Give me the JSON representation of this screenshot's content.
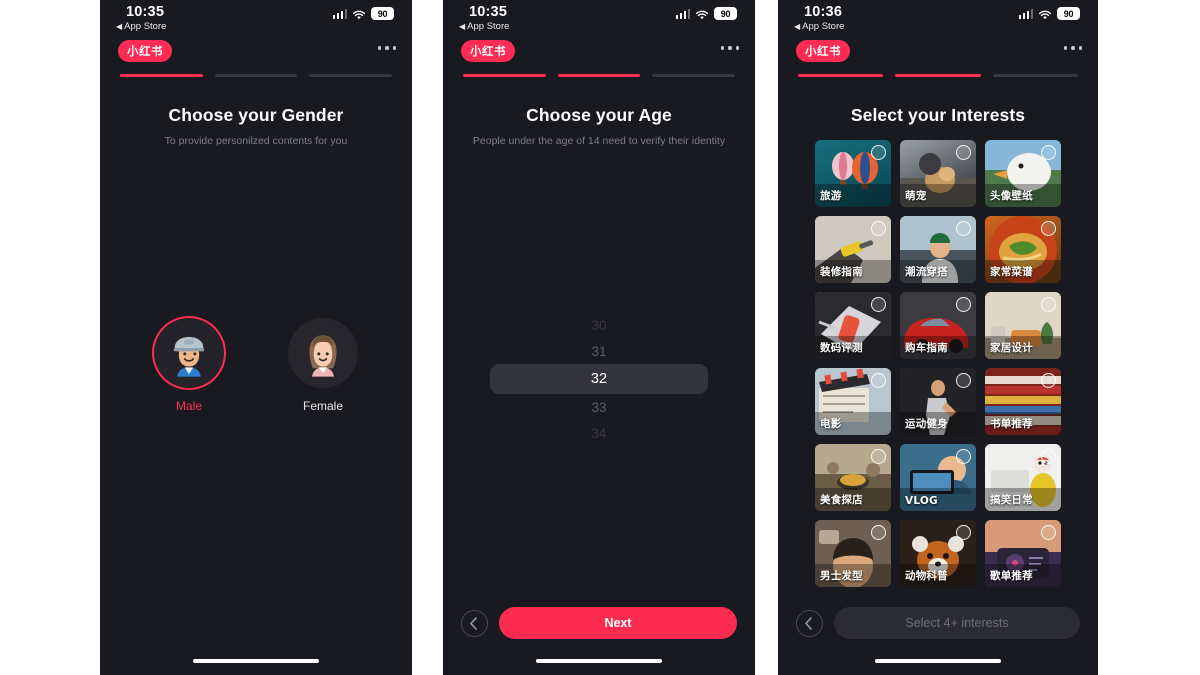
{
  "screens": [
    {
      "id": "gender",
      "status": {
        "time": "10:35",
        "back_app": "App Store",
        "battery": "90"
      },
      "header": {
        "logo": "小红书",
        "menu": "more-options"
      },
      "progress": {
        "total": 3,
        "active": 1
      },
      "title": "Choose your Gender",
      "subtitle": "To provide personilzed contents for you",
      "genders": [
        {
          "label": "Male",
          "selected": true
        },
        {
          "label": "Female",
          "selected": false
        }
      ]
    },
    {
      "id": "age",
      "status": {
        "time": "10:35",
        "back_app": "App Store",
        "battery": "90"
      },
      "header": {
        "logo": "小红书",
        "menu": "more-options"
      },
      "progress": {
        "total": 3,
        "active": 2
      },
      "title": "Choose your Age",
      "subtitle": "People under the age of 14 need to verify their identity",
      "age_picker": {
        "options": [
          "30",
          "31",
          "32",
          "33",
          "34"
        ],
        "selected": "32",
        "selected_index": 2
      },
      "bottom": {
        "back": "back-chevron",
        "cta_label": "Next",
        "cta_enabled": true
      }
    },
    {
      "id": "interests",
      "status": {
        "time": "10:36",
        "back_app": "App Store",
        "battery": "90"
      },
      "header": {
        "logo": "小红书",
        "menu": "more-options"
      },
      "progress": {
        "total": 3,
        "active": 2
      },
      "title": "Select your Interests",
      "bottom": {
        "back": "back-chevron",
        "cta_label": "Select 4+ interests",
        "cta_enabled": false
      },
      "interests": [
        {
          "label": "旅游",
          "img": "hot-air-balloons",
          "c1": "#17707e",
          "c2": "#0c4b58",
          "kind": "balloons"
        },
        {
          "label": "萌宠",
          "img": "man-with-dog",
          "c1": "#9aa0a6",
          "c2": "#3a3d42",
          "kind": "pets"
        },
        {
          "label": "头像壁纸",
          "img": "duck-closeup",
          "c1": "#8fb9d8",
          "c2": "#4a6b4e",
          "kind": "duck"
        },
        {
          "label": "装修指南",
          "img": "drill-wall",
          "c1": "#c9c3bb",
          "c2": "#6e6760",
          "kind": "drill"
        },
        {
          "label": "潮流穿搭",
          "img": "man-green-cap",
          "c1": "#b7c4cc",
          "c2": "#4e5a63",
          "kind": "fashion"
        },
        {
          "label": "家常菜谱",
          "img": "noodle-bowl",
          "c1": "#d4661f",
          "c2": "#6c3f14",
          "kind": "food"
        },
        {
          "label": "数码评测",
          "img": "phone-and-laptop",
          "c1": "#d8d8dc",
          "c2": "#2c2c31",
          "kind": "tech"
        },
        {
          "label": "购车指南",
          "img": "red-sports-car",
          "c1": "#c2282a",
          "c2": "#4b1718",
          "kind": "car"
        },
        {
          "label": "家居设计",
          "img": "living-room",
          "c1": "#d8cbb8",
          "c2": "#6d604f",
          "kind": "interior"
        },
        {
          "label": "电影",
          "img": "clapperboard",
          "c1": "#9db4c4",
          "c2": "#4c5a66",
          "kind": "movie"
        },
        {
          "label": "运动健身",
          "img": "runner",
          "c1": "#8a8a8f",
          "c2": "#1c1c20",
          "kind": "fitness"
        },
        {
          "label": "书单推荐",
          "img": "stacked-books",
          "c1": "#c0392b",
          "c2": "#7a2119",
          "kind": "books"
        },
        {
          "label": "美食探店",
          "img": "street-food",
          "c1": "#b9a789",
          "c2": "#5e5440",
          "kind": "streetfood"
        },
        {
          "label": "VLOG",
          "img": "phone-recording",
          "c1": "#4f98c4",
          "c2": "#1d4a66",
          "kind": "vlog"
        },
        {
          "label": "搞笑日常",
          "img": "rubber-chicken-funny",
          "c1": "#efefef",
          "c2": "#c9c9c9",
          "kind": "funny"
        },
        {
          "label": "男士发型",
          "img": "barber-haircut",
          "c1": "#8d7f74",
          "c2": "#2e2723",
          "kind": "hair"
        },
        {
          "label": "动物科普",
          "img": "red-panda",
          "c1": "#a8631f",
          "c2": "#3a2413",
          "kind": "panda"
        },
        {
          "label": "歌单推荐",
          "img": "music-player-sunset",
          "c1": "#c28a73",
          "c2": "#3a2a4a",
          "kind": "music"
        }
      ]
    }
  ]
}
